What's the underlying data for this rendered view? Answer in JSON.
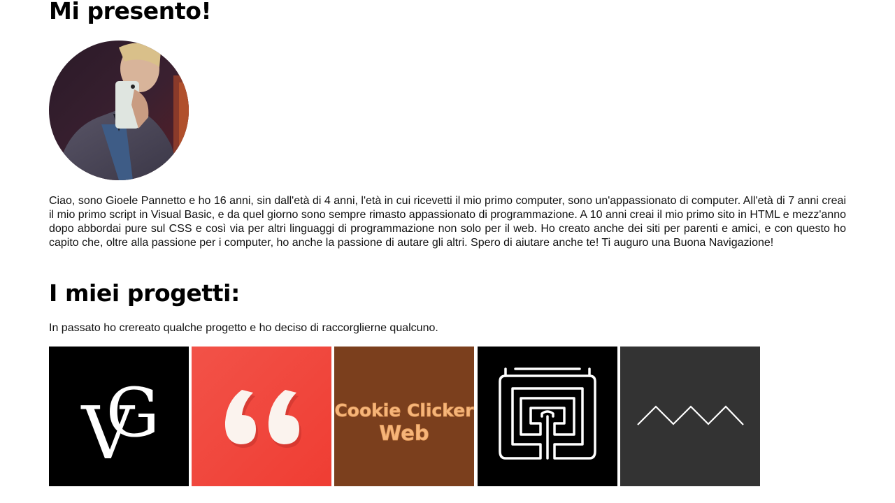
{
  "about": {
    "title": "Mi presento!",
    "bio": "Ciao, sono Gioele Pannetto e ho 16 anni, sin dall'età di 4 anni, l'età in cui ricevetti il mio primo computer, sono un'appassionato di computer. All'età di 7 anni creai il mio primo script in Visual Basic, e da quel giorno sono sempre rimasto appassionato di programmazione. A 10 anni creai il mio primo sito in HTML e mezz'anno dopo abbordai pure sul CSS e così via per altri linguaggi di programmazione non solo per il web. Ho creato anche dei siti per parenti e amici, e con questo ho capito che, oltre alla passione per i computer, ho anche la passione di autare gli altri. Spero di aiutare anche te! Ti auguro una Buona Navigazione!"
  },
  "projects": {
    "title": "I miei progetti:",
    "intro": "In passato ho crereato qualche progetto e ho deciso di raccorglierne qualcuno.",
    "items": [
      {
        "name": "vg-logo",
        "bg": "#000000",
        "logo_text": "VG"
      },
      {
        "name": "quotes",
        "bg": "#f0433a"
      },
      {
        "name": "cookie-clicker-web",
        "bg": "#7b3f1d",
        "text_line1": "Cookie Clicker",
        "text_line2": "Web"
      },
      {
        "name": "maze",
        "bg": "#000000"
      },
      {
        "name": "zigzag",
        "bg": "#333333"
      }
    ]
  }
}
